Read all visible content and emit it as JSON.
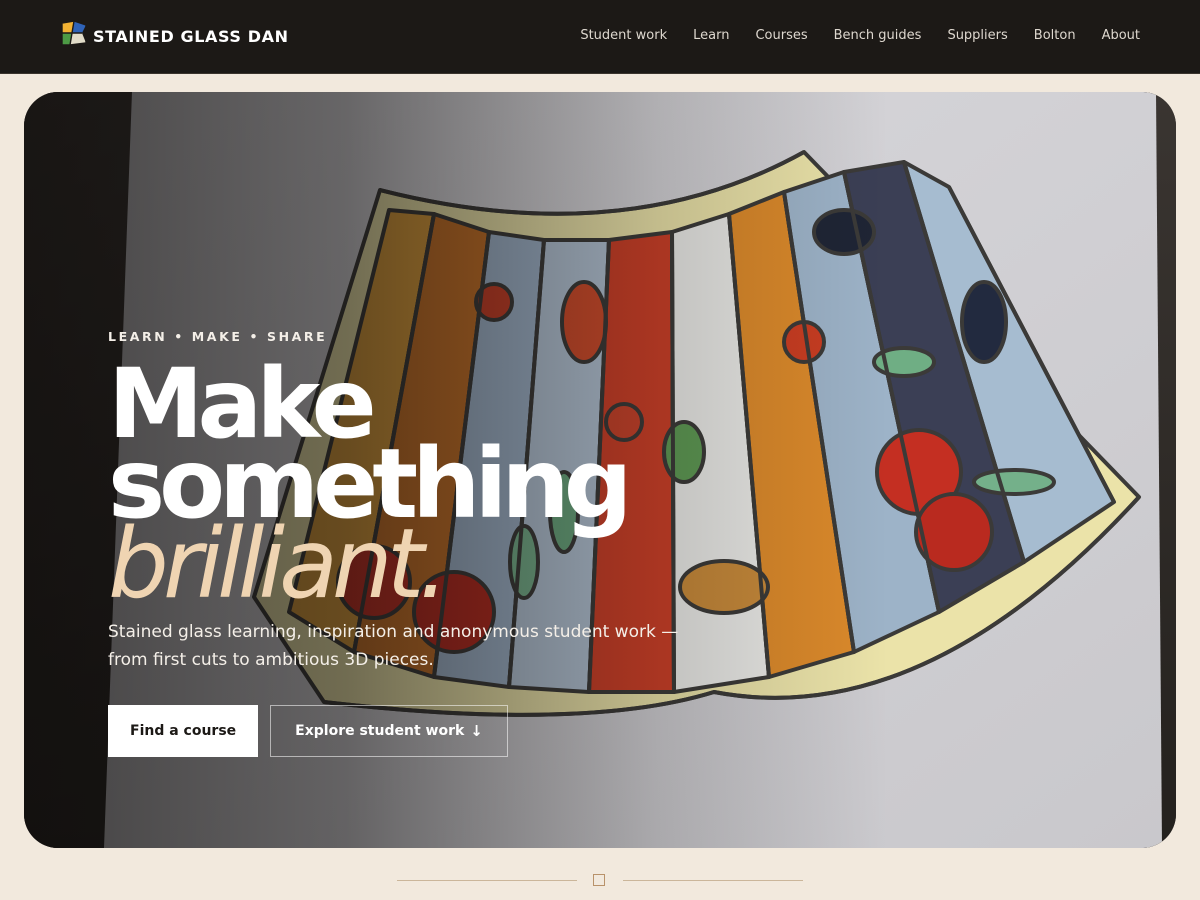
{
  "brand": {
    "name": "STAINED GLASS DAN",
    "logo_icon": "stained-glass-logo-icon"
  },
  "nav": [
    {
      "label": "Student work"
    },
    {
      "label": "Learn"
    },
    {
      "label": "Courses"
    },
    {
      "label": "Bench guides"
    },
    {
      "label": "Suppliers"
    },
    {
      "label": "Bolton"
    },
    {
      "label": "About"
    }
  ],
  "hero": {
    "eyebrow": "LEARN • MAKE • SHARE",
    "headline_1": "Make",
    "headline_2": "something",
    "headline_accent": "brilliant.",
    "subhead_1": "Stained glass learning, inspiration and anonymous student work —",
    "subhead_2": "from first cuts to ambitious 3D pieces.",
    "primary_cta": "Find a course",
    "secondary_cta": "Explore student work",
    "secondary_cta_icon": "↓"
  },
  "colors": {
    "header_bg": "#1c1916",
    "page_bg": "#f2e9dd",
    "accent_text": "#efd4b2"
  }
}
